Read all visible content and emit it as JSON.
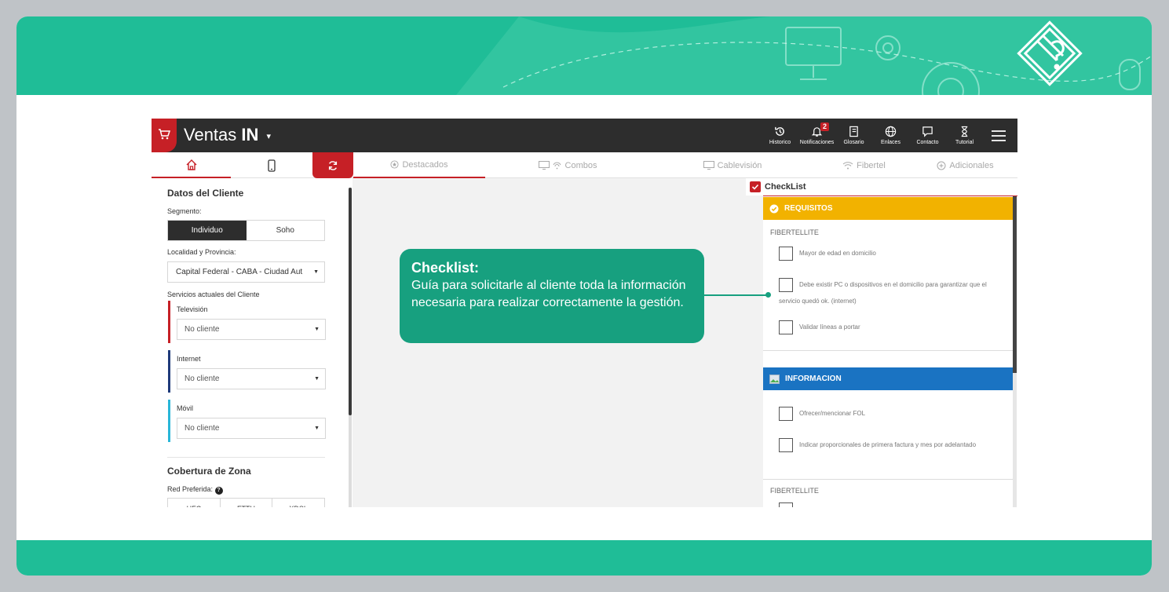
{
  "app": {
    "brand_prefix": "Ventas",
    "brand_bold": "IN",
    "brand_caret": "▾"
  },
  "toolbar": [
    {
      "label": "Historico",
      "icon": "history-icon"
    },
    {
      "label": "Notificaciones",
      "icon": "bell-icon",
      "badge": "2"
    },
    {
      "label": "Glosario",
      "icon": "book-icon"
    },
    {
      "label": "Enlaces",
      "icon": "globe-icon"
    },
    {
      "label": "Contacto",
      "icon": "chat-icon"
    },
    {
      "label": "Tutorial",
      "icon": "hourglass-icon"
    }
  ],
  "categories": [
    {
      "label": "Destacados",
      "icon": "star-badge-icon"
    },
    {
      "label": "Combos",
      "icon": "tv-wifi-icon",
      "prefix": "+"
    },
    {
      "label": "Cablevisión",
      "icon": "tv-icon"
    },
    {
      "label": "Fibertel",
      "icon": "wifi-icon"
    },
    {
      "label": "Adicionales",
      "icon": "plus-circle-icon"
    }
  ],
  "sidebar": {
    "title": "Datos del Cliente",
    "segment_label": "Segmento:",
    "segment_options": [
      "Individuo",
      "Soho"
    ],
    "location_label": "Localidad y Provincia:",
    "location_value": "Capital Federal - CABA - Ciudad Aut",
    "services_label": "Servicios actuales del Cliente",
    "services": [
      {
        "name": "Televisión",
        "value": "No cliente",
        "color": "#c62026"
      },
      {
        "name": "Internet",
        "value": "No cliente",
        "color": "#1f3a7a"
      },
      {
        "name": "Móvil",
        "value": "No cliente",
        "color": "#29b6d8"
      }
    ],
    "coverage_title": "Cobertura de Zona",
    "network_label": "Red Preferida:",
    "network_options": [
      "HFC",
      "FTTH",
      "XDSL"
    ]
  },
  "checklist": {
    "title": "CheckList",
    "requisitos_title": "REQUISITOS",
    "group1": "FIBERTELLITE",
    "requisitos_items": [
      "Mayor de edad en domicilio",
      "Debe existir PC o dispositivos en el domicilio para garantizar que el servicio quedó ok. (internet)",
      "Validar líneas a portar"
    ],
    "info_title": "INFORMACION",
    "info_items": [
      "Ofrecer/mencionar FOL",
      "Indicar proporcionales de primera factura y mes por adelantado"
    ],
    "group2": "FIBERTELLITE"
  },
  "callout": {
    "title": "Checklist:",
    "body": "Guía para solicitarle al cliente toda la información necesaria para realizar correctamente la gestión."
  },
  "colors": {
    "accent_green": "#1fbd97",
    "brand_red": "#c62026",
    "requisitos": "#f2b200",
    "informacion": "#1a73c2"
  }
}
